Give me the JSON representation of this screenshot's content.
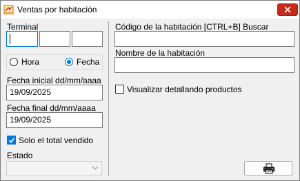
{
  "window": {
    "title": "Ventas por habitación",
    "close_icon": "close-icon",
    "accent_color": "#c42b1c"
  },
  "terminal": {
    "label": "Terminal",
    "fields": [
      "",
      "",
      ""
    ]
  },
  "mode": {
    "options": [
      {
        "label": "Hora",
        "selected": false
      },
      {
        "label": "Fecha",
        "selected": true
      }
    ]
  },
  "fecha_inicial": {
    "label": "Fecha inicial dd/mm/aaaa",
    "value": "19/09/2025"
  },
  "fecha_final": {
    "label": "Fecha final dd/mm/aaaa",
    "value": "19/09/2025"
  },
  "solo_total": {
    "label": "Solo el total vendido",
    "checked": true
  },
  "estado": {
    "label": "Estado",
    "value": ""
  },
  "codigo_habitacion": {
    "label": "Código de la habitación [CTRL+B] Buscar",
    "value": ""
  },
  "nombre_habitacion": {
    "label": "Nombre de la habitación",
    "value": ""
  },
  "visualizar_productos": {
    "label": "Visualizar detallando productos",
    "checked": false
  },
  "print_button": {
    "icon": "printer-icon"
  }
}
